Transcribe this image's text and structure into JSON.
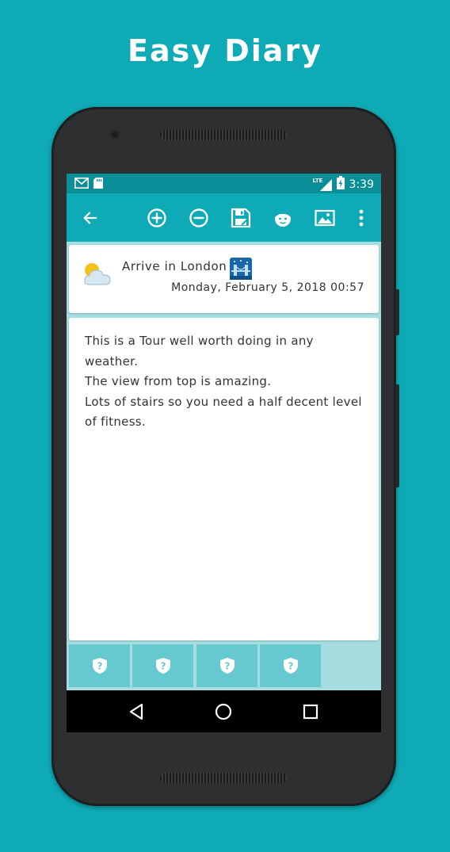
{
  "promo": {
    "title": "Easy Diary"
  },
  "status_bar": {
    "network": "LTE",
    "time": "3:39"
  },
  "toolbar": {
    "icons": [
      "back-arrow-icon",
      "zoom-in-icon",
      "zoom-out-icon",
      "save-icon",
      "face-icon",
      "photo-icon",
      "more-vert-icon"
    ],
    "color": "#0eaab5"
  },
  "diary": {
    "title": "Arrive in London",
    "date": "Monday, February 5, 2018 00:57",
    "weather_icon": "partly-cloudy-icon",
    "title_icon": "bridge-icon",
    "body": [
      "This is a Tour well worth doing in any",
      "weather.",
      "The view from top is amazing.",
      "Lots of stairs so you need a half decent level",
      "of fitness."
    ]
  },
  "photos": {
    "count": 4,
    "placeholder_icon": "shield-question-icon"
  },
  "colors": {
    "accent": "#0eaab5",
    "status_bar": "#0a8f98",
    "content_bg": "#a6dde1",
    "slot": "#66c9cf"
  }
}
